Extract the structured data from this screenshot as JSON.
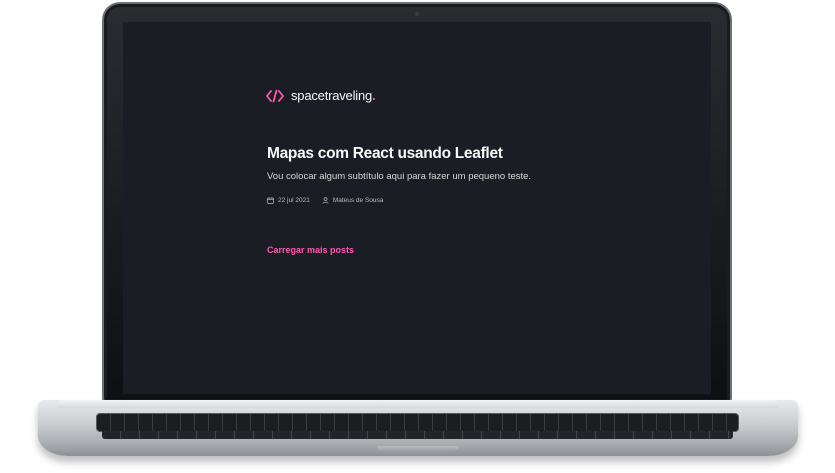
{
  "app": {
    "logo_text": "spacetraveling",
    "logo_dot": ".",
    "logo_icon": "code-brackets-icon"
  },
  "post": {
    "title": "Mapas com React usando Leaflet",
    "subtitle": "Vou colocar algum subtítulo aqui para fazer um pequeno teste.",
    "date": "22 jul 2021",
    "date_icon": "calendar-icon",
    "author": "Mateus de Sousa",
    "author_icon": "user-icon"
  },
  "actions": {
    "load_more_label": "Carregar mais posts"
  },
  "colors": {
    "background": "#1a1d23",
    "accent": "#ff57b2",
    "heading": "#f8f8f8",
    "body_text": "#d7d7d7",
    "meta_text": "#bbbbbb"
  }
}
